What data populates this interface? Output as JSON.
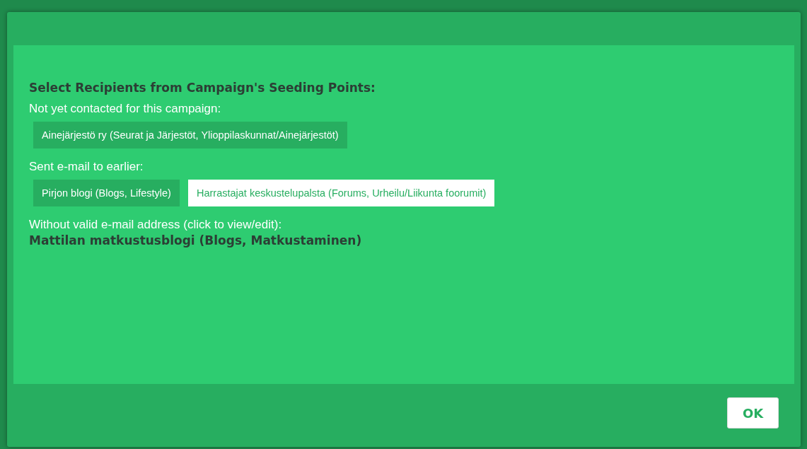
{
  "dialog": {
    "heading": "Select Recipients from Campaign's Seeding Points:",
    "sections": [
      {
        "label": "Not yet contacted for this campaign:",
        "kind": "chips",
        "items": [
          {
            "text": "Ainejärjestö ry (Seurat ja Järjestöt, Ylioppilaskunnat/Ainejärjestöt)",
            "selected": false
          }
        ]
      },
      {
        "label": "Sent e-mail to earlier:",
        "kind": "chips",
        "items": [
          {
            "text": "Pirjon blogi (Blogs, Lifestyle)",
            "selected": false
          },
          {
            "text": "Harrastajat keskustelupalsta (Forums, Urheilu/Liikunta foorumit)",
            "selected": true
          }
        ]
      },
      {
        "label": "Without valid e-mail address (click to view/edit):",
        "kind": "links",
        "items": [
          {
            "text": "Mattilan matkustusblogi (Blogs, Matkustaminen)"
          }
        ]
      }
    ],
    "buttons": [
      "OK"
    ]
  }
}
